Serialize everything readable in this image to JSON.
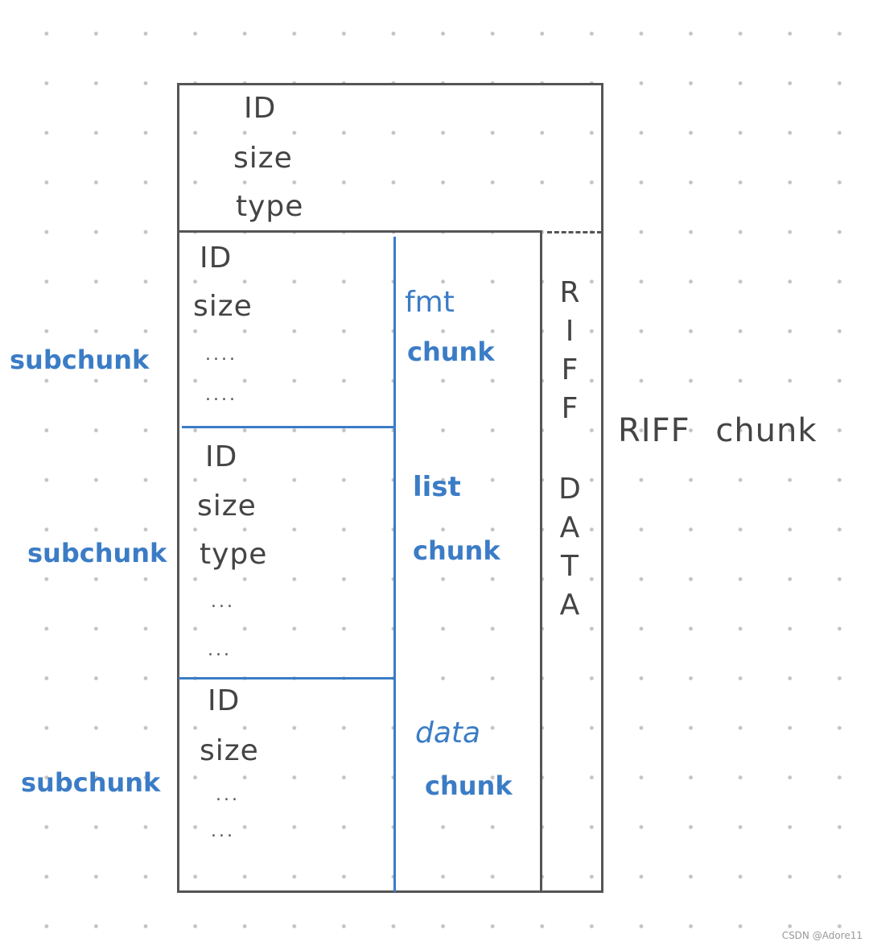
{
  "header": {
    "fields": [
      "ID",
      "size",
      "type"
    ]
  },
  "subchunks": [
    {
      "side_label": "subchunk",
      "fields": [
        "ID",
        "size",
        "....",
        "...."
      ],
      "chunk_label": [
        "fmt",
        "chunk"
      ]
    },
    {
      "side_label": "subchunk",
      "fields": [
        "ID",
        "size",
        "type",
        "...",
        "..."
      ],
      "chunk_label": [
        "list",
        "chunk"
      ]
    },
    {
      "side_label": "subchunk",
      "fields": [
        "ID",
        "size",
        "...",
        "..."
      ],
      "chunk_label": [
        "data",
        "chunk"
      ]
    }
  ],
  "riff_data_label": [
    "R",
    "I",
    "F",
    "F",
    "",
    "D",
    "A",
    "T",
    "A"
  ],
  "riff_chunk_label": "RIFF chunk",
  "colors": {
    "outline": "#555555",
    "blue": "#3b7cc6"
  },
  "watermark": "CSDN @Adore11"
}
